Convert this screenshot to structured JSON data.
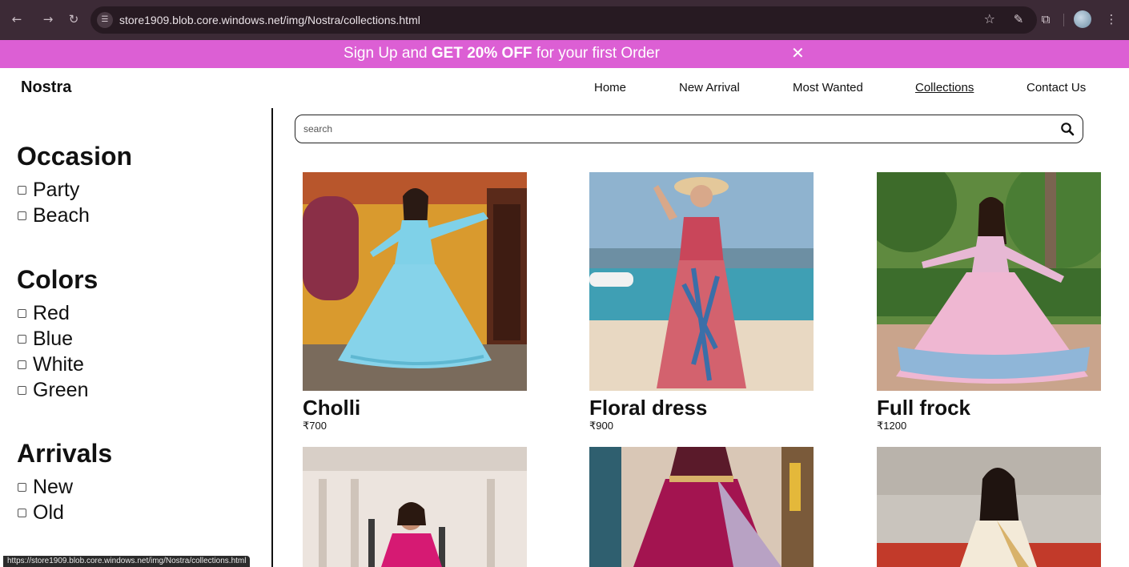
{
  "browser": {
    "url": "store1909.blob.core.windows.net/img/Nostra/collections.html",
    "status_url": "https://store1909.blob.core.windows.net/img/Nostra/collections.html"
  },
  "promo": {
    "prefix": "Sign Up and ",
    "highlight": "GET 20% OFF",
    "suffix": " for your first Order",
    "close_glyph": "✕"
  },
  "header": {
    "brand": "Nostra",
    "nav": [
      "Home",
      "New Arrival",
      "Most Wanted",
      "Collections",
      "Contact Us"
    ],
    "active": "Collections"
  },
  "filters": [
    {
      "title": "Occasion",
      "options": [
        "Party",
        "Beach"
      ]
    },
    {
      "title": "Colors",
      "options": [
        "Red",
        "Blue",
        "White",
        "Green"
      ]
    },
    {
      "title": "Arrivals",
      "options": [
        "New",
        "Old"
      ]
    }
  ],
  "search": {
    "placeholder": "search"
  },
  "products": [
    {
      "name": "Cholli",
      "price": "₹700"
    },
    {
      "name": "Floral dress",
      "price": "₹900"
    },
    {
      "name": "Full frock",
      "price": "₹1200"
    },
    {
      "name": "",
      "price": ""
    },
    {
      "name": "",
      "price": ""
    },
    {
      "name": "",
      "price": ""
    }
  ],
  "colors": {
    "browser_chrome": "#3c2a36",
    "promo_bg": "#dc5fd4"
  }
}
